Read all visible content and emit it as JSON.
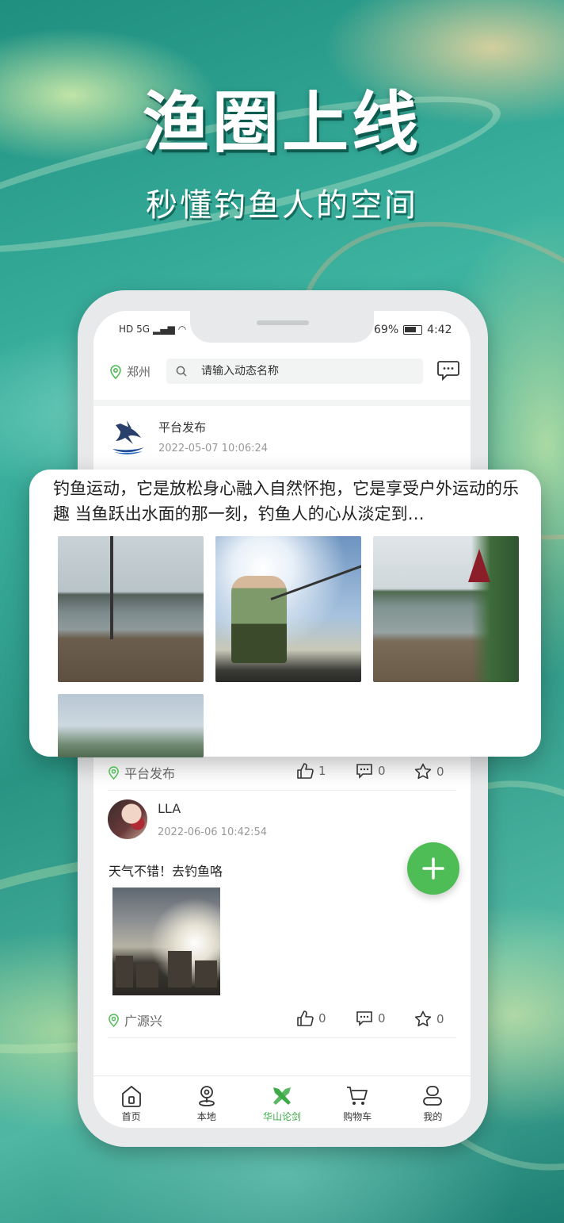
{
  "promo": {
    "headline": "渔圈上线",
    "subline": "秒懂钓鱼人的空间"
  },
  "status_bar": {
    "network": "HD 5G",
    "battery": "69%",
    "time": "4:42"
  },
  "search": {
    "location": "郑州",
    "placeholder": "请输入动态名称"
  },
  "posts": [
    {
      "author": "平台发布",
      "time": "2022-05-07 10:06:24",
      "text": "钓鱼运动，它是放松身心融入自然怀抱，它是享受户外运动的乐趣 当鱼跃出水面的那一刻，钓鱼人的心从淡定到…",
      "location": "平台发布",
      "likes": "1",
      "comments": "0",
      "favorites": "0"
    },
    {
      "author": "LLA",
      "time": "2022-06-06 10:42:54",
      "text": "天气不错！去钓鱼咯",
      "location": "广源兴",
      "likes": "0",
      "comments": "0",
      "favorites": "0"
    }
  ],
  "tabbar": [
    {
      "label": "首页",
      "icon": "home-icon"
    },
    {
      "label": "本地",
      "icon": "location-pin-icon"
    },
    {
      "label": "华山论剑",
      "icon": "crossed-swords-icon"
    },
    {
      "label": "购物车",
      "icon": "cart-icon"
    },
    {
      "label": "我的",
      "icon": "user-icon"
    }
  ],
  "colors": {
    "accent": "#3daa48",
    "fab": "#4fbd55",
    "background": "#2e9a8a"
  }
}
